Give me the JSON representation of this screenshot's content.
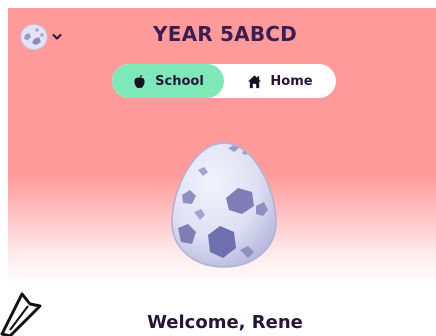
{
  "header": {
    "class_name": "YEAR 5ABCD",
    "avatar_icon": "egg-avatar-icon",
    "menu_icon": "chevron-down-icon"
  },
  "toggle": {
    "options": [
      {
        "label": "School",
        "icon": "apple-icon",
        "active": true
      },
      {
        "label": "Home",
        "icon": "house-icon",
        "active": false
      }
    ],
    "active_color": "#7ee8b8"
  },
  "hero": {
    "background_color": "#ff9a9b",
    "illustration": "spotted-egg"
  },
  "welcome": {
    "text": "Welcome, Rene"
  }
}
